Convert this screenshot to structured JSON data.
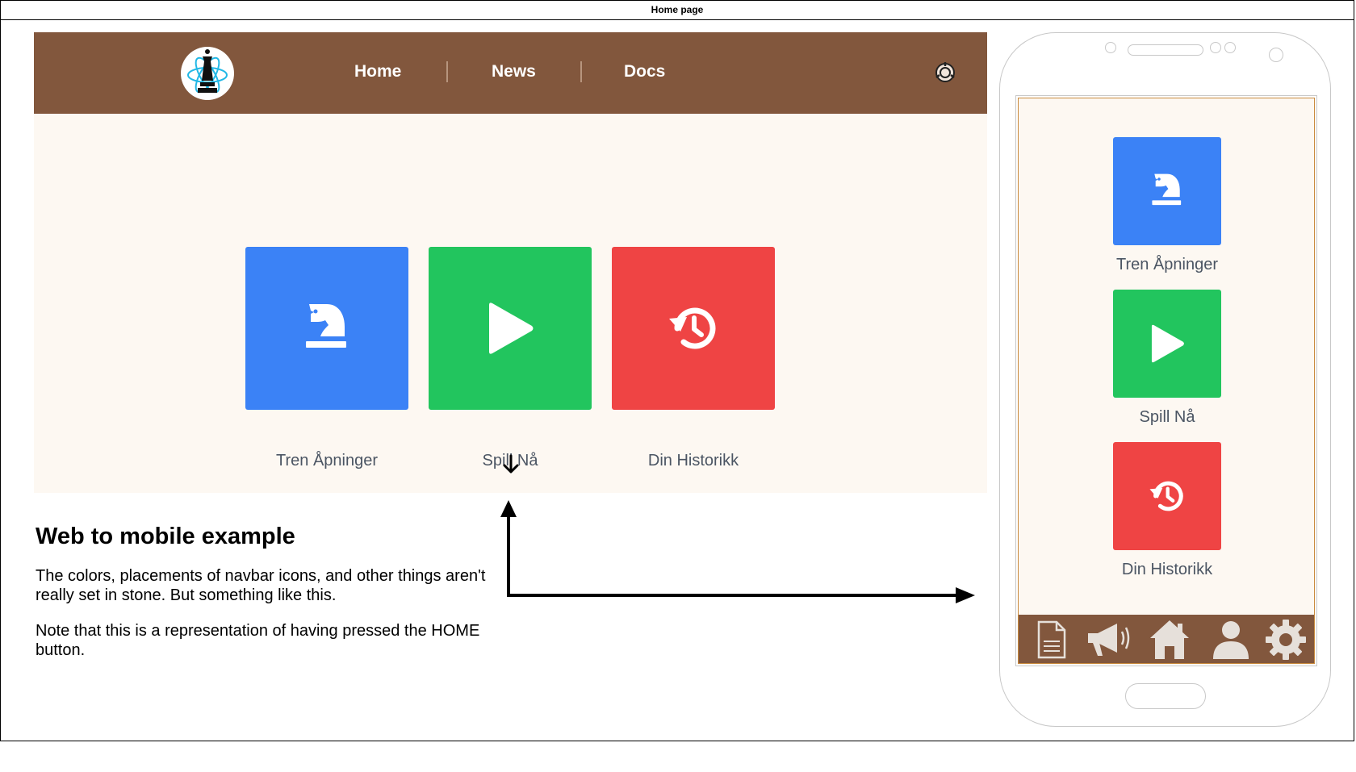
{
  "frame": {
    "title": "Home page"
  },
  "web": {
    "nav": {
      "home": "Home",
      "news": "News",
      "docs": "Docs"
    },
    "tiles": [
      {
        "label": "Tren Åpninger",
        "icon": "chess-knight-icon",
        "color": "#3b82f6"
      },
      {
        "label": "Spill Nå",
        "icon": "play-icon",
        "color": "#22c55e"
      },
      {
        "label": "Din Historikk",
        "icon": "history-icon",
        "color": "#ef4444"
      }
    ],
    "navbar_color": "#82573d",
    "background_color": "#fdf8f2"
  },
  "description": {
    "heading": "Web to mobile example",
    "para1": "The colors, placements of navbar icons, and other things aren't really set in stone. But something like this.",
    "para2": "Note that this is a representation of having pressed the HOME button."
  },
  "mobile": {
    "tiles": [
      {
        "label": "Tren Åpninger",
        "icon": "chess-knight-icon"
      },
      {
        "label": "Spill Nå",
        "icon": "play-icon"
      },
      {
        "label": "Din Historikk",
        "icon": "history-icon"
      }
    ],
    "bottom_nav": [
      "docs-icon",
      "megaphone-icon",
      "home-icon",
      "user-icon",
      "gear-icon"
    ]
  }
}
